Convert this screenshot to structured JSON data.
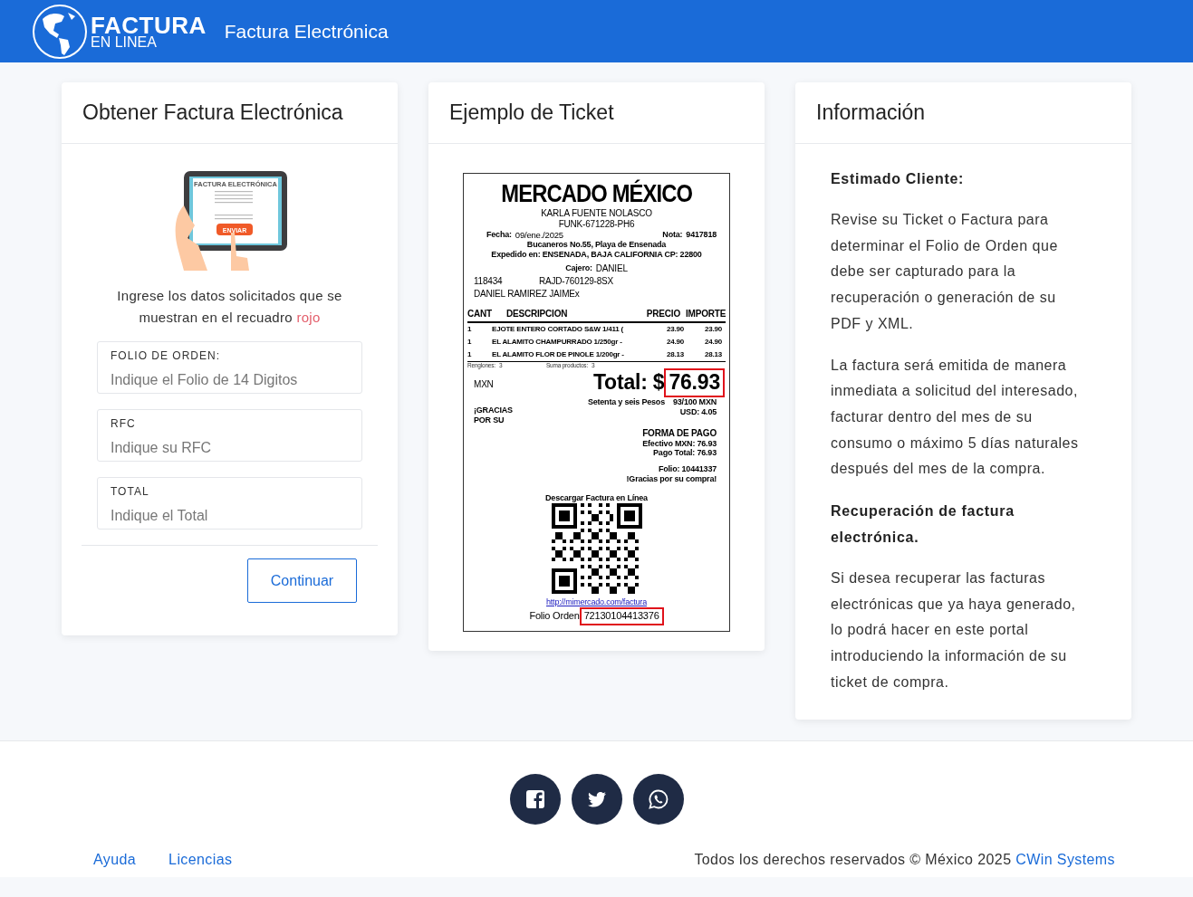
{
  "header": {
    "logo_main": "FACTURA",
    "logo_sub": "EN LINEA",
    "title": "Factura Electrónica"
  },
  "form_card": {
    "title": "Obtener Factura Electrónica",
    "illustration": {
      "doc_title": "FACTURA ELECTRÓNICA",
      "button": "ENVIAR"
    },
    "instructions": "Ingrese los datos solicitados que se muestran en el recuadro",
    "instructions_highlight": "rojo",
    "fields": [
      {
        "label": "FOLIO DE ORDEN:",
        "placeholder": "Indique el Folio de 14 Digitos"
      },
      {
        "label": "RFC",
        "placeholder": "Indique su RFC"
      },
      {
        "label": "TOTAL",
        "placeholder": "Indique el Total"
      }
    ],
    "button": "Continuar"
  },
  "ticket_card": {
    "title": "Ejemplo de Ticket",
    "ticket": {
      "store": "MERCADO MÉXICO",
      "header_lines": [
        "KARLA FUENTE NOLASCO",
        "FUNK-671228-PH6"
      ],
      "fecha_label": "Fecha:",
      "fecha": "09/ene./2025",
      "nota_label": "Nota:",
      "nota": "9417818",
      "address": "Bucaneros No.55, Playa de Ensenada",
      "expedido": "Expedido en: ENSENADA, BAJA CALIFORNIA CP: 22800",
      "cajero_label": "Cajero:",
      "cajero": "DANIEL",
      "client_id": "118434",
      "client_rfc": "RAJD-760129-8SX",
      "client_name": "DANIEL RAMIREZ JAIMEx",
      "columns": [
        "CANT",
        "DESCRIPCION",
        "PRECIO",
        "IMPORTE"
      ],
      "items": [
        [
          "1",
          "EJOTE ENTERO CORTADO S&W 1/411 (",
          "23.90",
          "23.90"
        ],
        [
          "1",
          "EL ALAMITO CHAMPURRADO 1/250gr -",
          "24.90",
          "24.90"
        ],
        [
          "1",
          "EL ALAMITO FLOR DE PINOLE 1/200gr -",
          "28.13",
          "28.13"
        ]
      ],
      "renglones_label": "Renglones:",
      "renglones": "3",
      "suma_label": "Suma productos:",
      "suma": "3",
      "currency": "MXN",
      "total_label": "Total: $",
      "total": {
        "text": "76.93",
        "highlighted": true
      },
      "total_words": "Setenta y seis Pesos",
      "total_cents": "93/100  MXN",
      "usd": "USD: 4.05",
      "thanks_left": "¡GRACIAS POR SU",
      "payment": [
        "FORMA DE PAGO",
        "Efectivo MXN: 76.93",
        "Pago Total: 76.93"
      ],
      "folio": "Folio: 10441337",
      "thanks": "!Gracias por su compra!",
      "download": "Descargar Factura en Línea",
      "url": "http://mimercado.com/factura",
      "folio_orden_label": "Folio Orden",
      "folio_orden": {
        "text": "72130104413376",
        "highlighted": true
      }
    }
  },
  "info_card": {
    "title": "Información",
    "blocks": [
      {
        "kind": "heading",
        "text": "Estimado Cliente:"
      },
      {
        "kind": "paragraph",
        "text": "Revise su Ticket o Factura para determinar el Folio de Orden que debe ser capturado para la recuperación o generación de su PDF y XML."
      },
      {
        "kind": "paragraph",
        "text": "La factura será emitida de manera inmediata a solicitud del interesado, facturar dentro del mes de su consumo o máximo 5 días naturales después del mes de la compra."
      },
      {
        "kind": "heading",
        "text": "Recuperación de factura electrónica."
      },
      {
        "kind": "paragraph",
        "text": "Si desea recuperar las facturas electrónicas que ya haya generado, lo podrá hacer en este portal introduciendo la información de su ticket de compra."
      }
    ]
  },
  "footer": {
    "social": [
      {
        "kind": "facebook"
      },
      {
        "kind": "twitter"
      },
      {
        "kind": "whatsapp"
      }
    ],
    "links": [
      "Ayuda",
      "Licencias"
    ],
    "copyright": "Todos los derechos reservados © México 2025",
    "company": "CWin Systems"
  }
}
